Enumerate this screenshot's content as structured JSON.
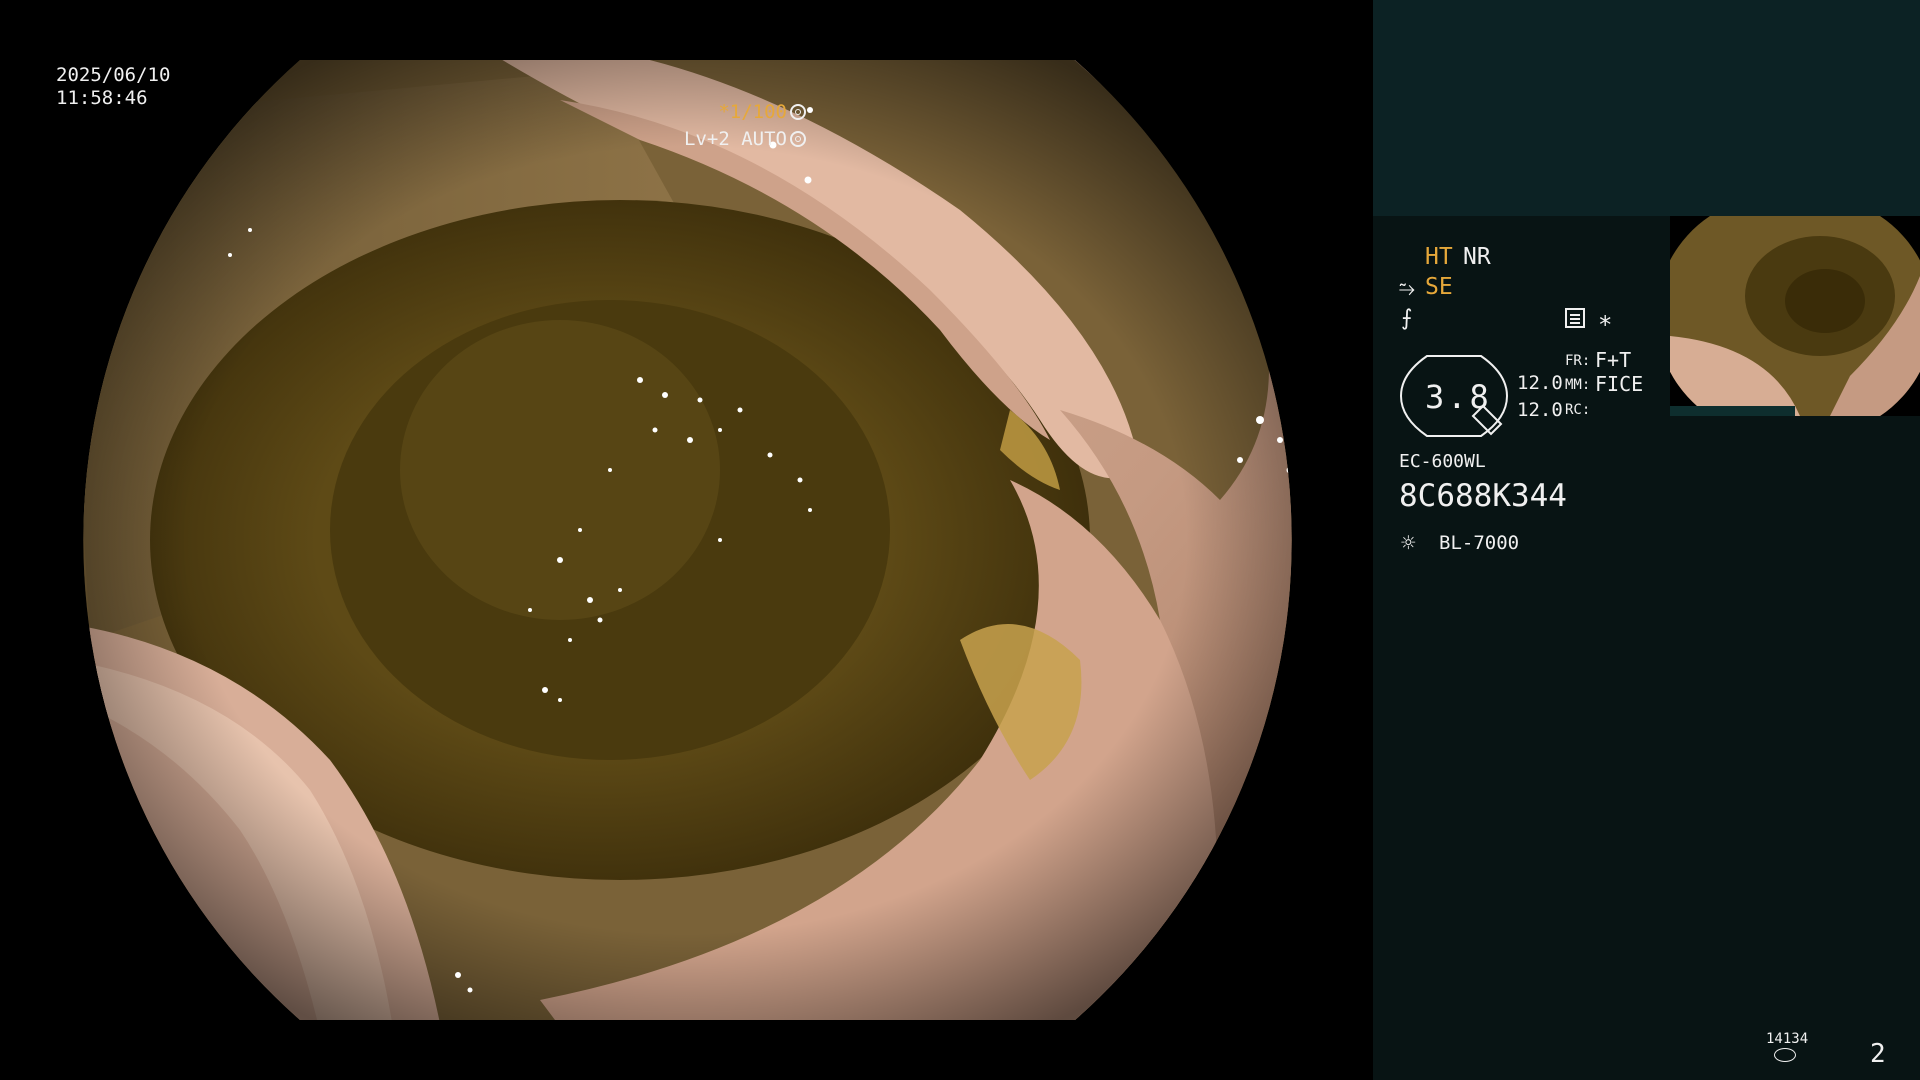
{
  "image": {
    "date": "2025/06/10",
    "time": "11:58:46",
    "shutter_speed": "*1/100",
    "iris": "Lv+2 AUTO"
  },
  "panel": {
    "ht": "HT",
    "nr": "NR",
    "se": "SE",
    "zoom_value": "3.8",
    "value_1": "12.0",
    "value_2": "12.0",
    "fr_label": "FR:",
    "fr_value": "F+T",
    "mm_label": "MM:",
    "mm_value": "FICE",
    "rc_label": "RC:",
    "scope_model": "EC-600WL",
    "serial_number": "8C688K344",
    "light_source": "BL-7000",
    "image_counter": "14134",
    "page_number": "2"
  },
  "icons": {
    "shutter": "aperture-icon",
    "iris": "iris-icon",
    "structure_enhance": "se-icon",
    "filter": "f-icon",
    "menu": "menu-icon",
    "light": "sun-icon",
    "storage": "disk-icon"
  },
  "colors": {
    "accent": "#e6a83a",
    "panel_background": "#081414",
    "panel_top": "#0c2224"
  }
}
